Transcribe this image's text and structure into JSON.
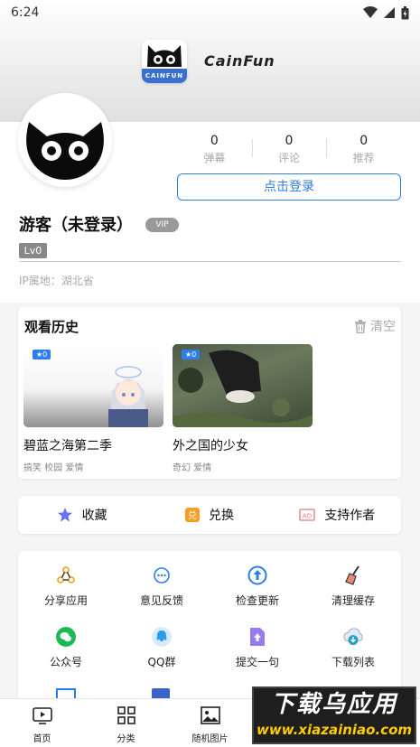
{
  "status_bar": {
    "time": "6:24"
  },
  "app": {
    "name": "CainFun",
    "logo_label": "CAINFUN"
  },
  "profile": {
    "stats": [
      {
        "value": "0",
        "label": "弹幕"
      },
      {
        "value": "0",
        "label": "评论"
      },
      {
        "value": "0",
        "label": "推荐"
      }
    ],
    "login_label": "点击登录",
    "username": "游客（未登录）",
    "vip": "VIP",
    "level": "Lv0",
    "ip": "IP属地：湖北省"
  },
  "history": {
    "title": "观看历史",
    "clear_label": "清空",
    "items": [
      {
        "badge": "★0",
        "title": "碧蓝之海第二季",
        "tags": "搞笑 校园 爱情"
      },
      {
        "badge": "★0",
        "title": "外之国的少女",
        "tags": "奇幻 爱情"
      }
    ]
  },
  "actions": [
    {
      "label": "收藏",
      "icon": "star-icon"
    },
    {
      "label": "兑换",
      "icon": "exchange-icon"
    },
    {
      "label": "支持作者",
      "icon": "support-icon"
    }
  ],
  "tools": [
    {
      "label": "分享应用",
      "icon": "share-icon"
    },
    {
      "label": "意见反馈",
      "icon": "feedback-icon"
    },
    {
      "label": "检查更新",
      "icon": "update-icon"
    },
    {
      "label": "清理缓存",
      "icon": "broom-icon"
    },
    {
      "label": "公众号",
      "icon": "wechat-icon"
    },
    {
      "label": "QQ群",
      "icon": "qq-icon"
    },
    {
      "label": "提交一句",
      "icon": "submit-icon"
    },
    {
      "label": "下载列表",
      "icon": "download-icon"
    }
  ],
  "bottom_nav": [
    {
      "label": "首页",
      "icon": "tv-icon"
    },
    {
      "label": "分类",
      "icon": "grid-icon"
    },
    {
      "label": "随机图片",
      "icon": "image-icon"
    }
  ],
  "watermark": {
    "main": "下载乌应用",
    "sub": "www.xiazainiao.com"
  },
  "colors": {
    "accent": "#2f7de1",
    "badge": "#2a7ef0",
    "vip": "#999999"
  }
}
